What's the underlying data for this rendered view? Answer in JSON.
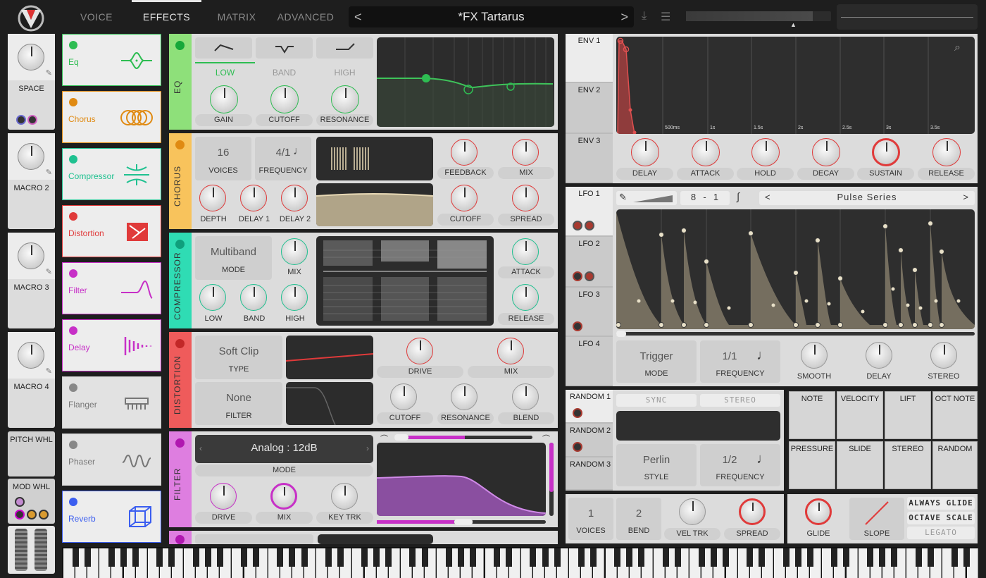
{
  "app": {
    "name": "Vital"
  },
  "tabs": [
    {
      "label": "VOICE"
    },
    {
      "label": "EFFECTS",
      "active": true
    },
    {
      "label": "MATRIX"
    },
    {
      "label": "ADVANCED"
    }
  ],
  "preset": {
    "name": "*FX Tartarus",
    "prev": "<",
    "next": ">"
  },
  "colors": {
    "eq": "#8ee07a",
    "chorus": "#f8c35c",
    "compressor": "#2fdcb4",
    "distortion": "#ef5b5b",
    "filter": "#cf4cd6",
    "delay": "#c84ec9",
    "reverb": "#3b5ef0",
    "flanger": "#999999",
    "phaser": "#999999"
  },
  "macros": [
    {
      "label": "SPACE"
    },
    {
      "label": "MACRO 2"
    },
    {
      "label": "MACRO 3"
    },
    {
      "label": "MACRO 4"
    }
  ],
  "wheels": {
    "pitch": "PITCH WHL",
    "mod": "MOD WHL"
  },
  "effects": [
    {
      "name": "Eq",
      "color": "#2ebd52",
      "on": true,
      "icon": "eq-icon"
    },
    {
      "name": "Chorus",
      "color": "#e08a12",
      "on": true,
      "icon": "chorus-icon"
    },
    {
      "name": "Compressor",
      "color": "#1fc190",
      "on": true,
      "icon": "compressor-icon"
    },
    {
      "name": "Distortion",
      "color": "#e03a3a",
      "on": true,
      "icon": "distortion-icon"
    },
    {
      "name": "Filter",
      "color": "#c730c7",
      "on": true,
      "icon": "filter-icon"
    },
    {
      "name": "Delay",
      "color": "#c730c7",
      "on": true,
      "icon": "delay-icon"
    },
    {
      "name": "Flanger",
      "color": "#888",
      "on": false,
      "icon": "flanger-icon"
    },
    {
      "name": "Phaser",
      "color": "#888",
      "on": false,
      "icon": "phaser-icon"
    },
    {
      "name": "Reverb",
      "color": "#3b5ef0",
      "on": true,
      "icon": "reverb-icon"
    }
  ],
  "eq": {
    "title": "EQ",
    "bands": [
      "LOW",
      "BAND",
      "HIGH"
    ],
    "knobs": [
      "GAIN",
      "CUTOFF",
      "RESONANCE"
    ]
  },
  "chorus": {
    "title": "CHORUS",
    "voices": "16",
    "voices_label": "VOICES",
    "freq": "4/1",
    "freq_label": "FREQUENCY",
    "knobs": [
      "FEEDBACK",
      "MIX",
      "DEPTH",
      "DELAY 1",
      "DELAY 2",
      "CUTOFF",
      "SPREAD"
    ]
  },
  "compressor": {
    "title": "COMPRESSOR",
    "mode": "Multiband",
    "mode_label": "MODE",
    "knobs": [
      "MIX",
      "ATTACK",
      "LOW",
      "BAND",
      "HIGH",
      "RELEASE"
    ]
  },
  "distortion": {
    "title": "DISTORTION",
    "type": "Soft Clip",
    "type_label": "TYPE",
    "filter": "None",
    "filter_label": "FILTER",
    "knobs": [
      "DRIVE",
      "MIX",
      "CUTOFF",
      "RESONANCE",
      "BLEND"
    ]
  },
  "filter": {
    "title": "FILTER",
    "mode": "Analog : 12dB",
    "mode_label": "MODE",
    "knobs": [
      "DRIVE",
      "MIX",
      "KEY TRK"
    ]
  },
  "env": {
    "tabs": [
      "ENV 1",
      "ENV 2",
      "ENV 3"
    ],
    "times": [
      "500ms",
      "1s",
      "1.5s",
      "2s",
      "2.5s",
      "3s",
      "3.5s"
    ],
    "knobs": [
      "DELAY",
      "ATTACK",
      "HOLD",
      "DECAY",
      "SUSTAIN",
      "RELEASE"
    ]
  },
  "lfo": {
    "tabs": [
      "LFO 1",
      "LFO 2",
      "LFO 3",
      "LFO 4"
    ],
    "grid_a": "8",
    "grid_sep": "-",
    "grid_b": "1",
    "shape": "Pulse Series",
    "mode": "Trigger",
    "mode_label": "MODE",
    "freq": "1/1",
    "freq_label": "FREQUENCY",
    "knobs": [
      "SMOOTH",
      "DELAY",
      "STEREO"
    ]
  },
  "random": {
    "tabs": [
      "RANDOM 1",
      "RANDOM 2",
      "RANDOM 3"
    ],
    "sync": "SYNC",
    "stereo": "STEREO",
    "style": "Perlin",
    "style_label": "STYLE",
    "freq": "1/2",
    "freq_label": "FREQUENCY"
  },
  "sources": [
    "NOTE",
    "VELOCITY",
    "LIFT",
    "OCT NOTE",
    "PRESSURE",
    "SLIDE",
    "STEREO",
    "RANDOM"
  ],
  "voice": {
    "voices": "1",
    "voices_label": "VOICES",
    "bend": "2",
    "bend_label": "BEND",
    "vel": "VEL TRK",
    "spread": "SPREAD"
  },
  "glide": {
    "glide": "GLIDE",
    "slope": "SLOPE",
    "always": "ALWAYS GLIDE",
    "octave": "OCTAVE SCALE",
    "legato": "LEGATO"
  }
}
